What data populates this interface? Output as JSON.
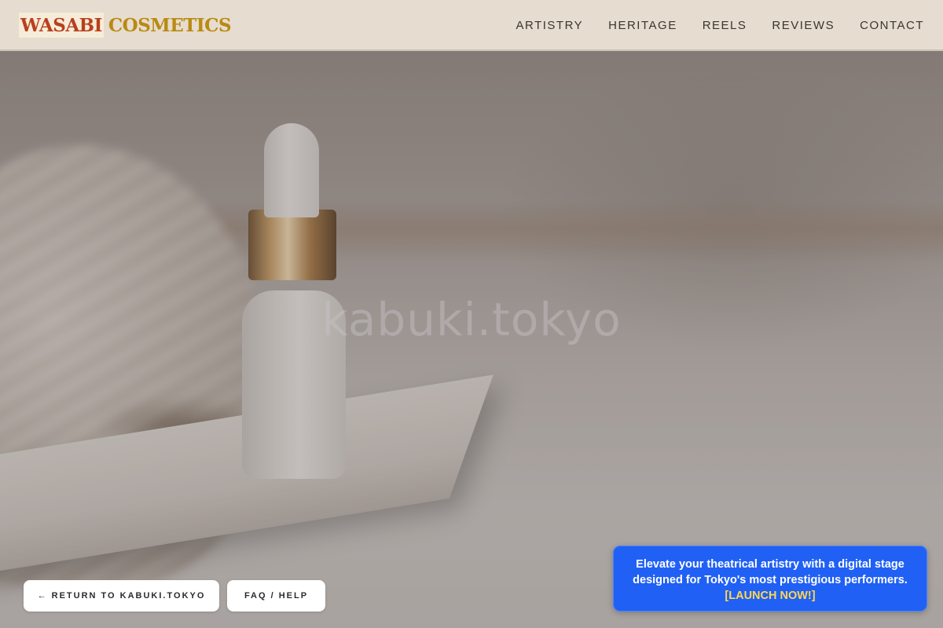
{
  "header": {
    "logo_part1": "WASABI",
    "logo_part2": "COSMETICS",
    "nav": [
      "ARTISTRY",
      "HERITAGE",
      "REELS",
      "REVIEWS",
      "CONTACT"
    ]
  },
  "hero": {
    "title": "kabuki.tokyo"
  },
  "buttons": {
    "return_label": "← RETURN TO KABUKI.TOKYO",
    "faq_label": "FAQ / HELP"
  },
  "promo": {
    "text": "Elevate your theatrical artistry with a digital stage designed for Tokyo's most prestigious performers.",
    "link_label": "[LAUNCH NOW!]"
  },
  "colors": {
    "header_bg": "#e6dccf",
    "logo_gold": "#b98a12",
    "logo_red": "#b8401c",
    "promo_bg": "#2060f5",
    "promo_link": "#ffd84d"
  }
}
